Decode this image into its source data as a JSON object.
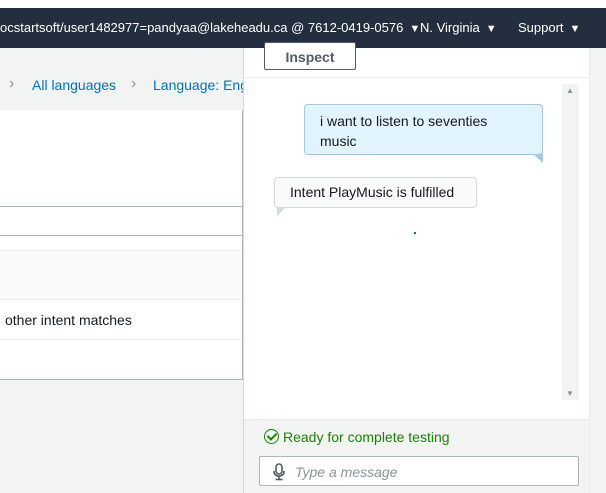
{
  "topbar": {
    "account": "ocstartsoft/user1482977=pandyaa@lakeheadu.ca @ 7612-0419-0576",
    "region": "N. Virginia",
    "support": "Support",
    "caret": "▼"
  },
  "breadcrumb": {
    "separator": "›",
    "items": [
      "All languages",
      "Language: English"
    ]
  },
  "table": {
    "row_text": "other intent matches"
  },
  "test_panel": {
    "inspect_label": "Inspect",
    "messages": [
      {
        "from": "user",
        "text": "i want to listen to seventies music"
      },
      {
        "from": "bot",
        "text": "Intent PlayMusic is fulfilled"
      }
    ],
    "status": "Ready for complete testing",
    "status_color": "#1d8102",
    "input_placeholder": "Type a message",
    "mic_icon": "microphone-icon",
    "status_icon": "check-circle-icon"
  },
  "colors": {
    "nav_bg": "#232f3e",
    "link": "#0073bb",
    "user_bubble": "#e1f3fd"
  }
}
